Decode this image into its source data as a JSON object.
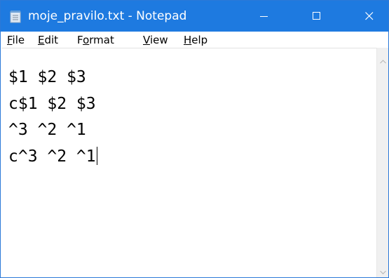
{
  "window": {
    "title": "moje_pravilo.txt - Notepad",
    "titlebar_color": "#1e7ae0"
  },
  "icons": {
    "app": "notepad-icon",
    "minimize": "minimize-icon",
    "maximize": "maximize-icon",
    "close": "close-icon",
    "scroll_up": "scroll-up-arrow-icon",
    "scroll_down": "scroll-down-arrow-icon"
  },
  "menu": {
    "items": [
      {
        "accel": "F",
        "rest": "ile"
      },
      {
        "accel": "E",
        "rest": "dit"
      },
      {
        "pre": "F",
        "accel": "o",
        "rest": "rmat"
      },
      {
        "accel": "V",
        "rest": "iew"
      },
      {
        "accel": "H",
        "rest": "elp"
      }
    ]
  },
  "editor": {
    "lines": [
      "$1 $2 $3",
      "c$1 $2 $3",
      "^3 ^2 ^1",
      "c^3 ^2 ^1"
    ]
  }
}
